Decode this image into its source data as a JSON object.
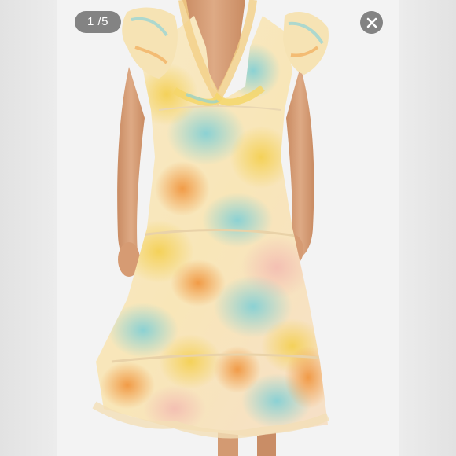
{
  "viewer": {
    "counter_text": "1 /5"
  },
  "icons": {
    "close": "close-icon"
  },
  "colors": {
    "overlay": "#6e6e6e",
    "background": "#e9e9e9",
    "dress_yellow": "#f5d66a",
    "dress_aqua": "#8fd3d8",
    "dress_orange": "#f2a24a",
    "dress_cream": "#f6ecd6",
    "skin": "#d9a27b"
  }
}
